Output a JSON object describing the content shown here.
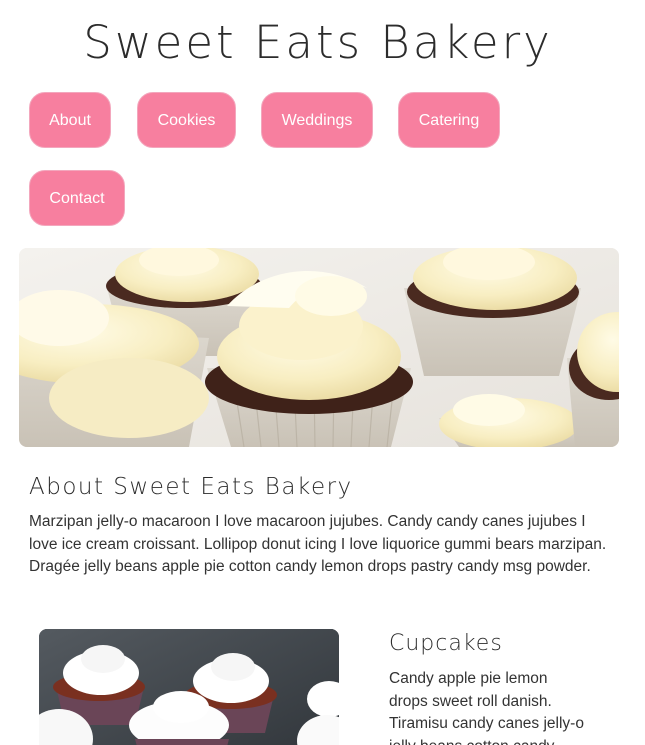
{
  "site": {
    "title": "Sweet Eats Bakery"
  },
  "nav": {
    "items": [
      {
        "label": "About"
      },
      {
        "label": "Cookies"
      },
      {
        "label": "Weddings"
      },
      {
        "label": "Catering"
      },
      {
        "label": "Contact"
      }
    ]
  },
  "about": {
    "heading": "About Sweet Eats Bakery",
    "body": "Marzipan jelly-o macaroon I love macaroon jujubes. Candy candy canes jujubes I love ice cream croissant. Lollipop donut icing I love liquorice gummi bears marzipan. Dragée jelly beans apple pie cotton candy lemon drops pastry candy msg powder."
  },
  "cupcakes": {
    "heading": "Cupcakes",
    "body": "Candy apple pie lemon drops sweet roll danish. Tiramisu candy canes jelly-o jelly beans cotton candy"
  },
  "colors": {
    "button_bg": "#f77f9f",
    "button_text": "#ffffff",
    "text": "#333333",
    "background": "#ffffff"
  }
}
